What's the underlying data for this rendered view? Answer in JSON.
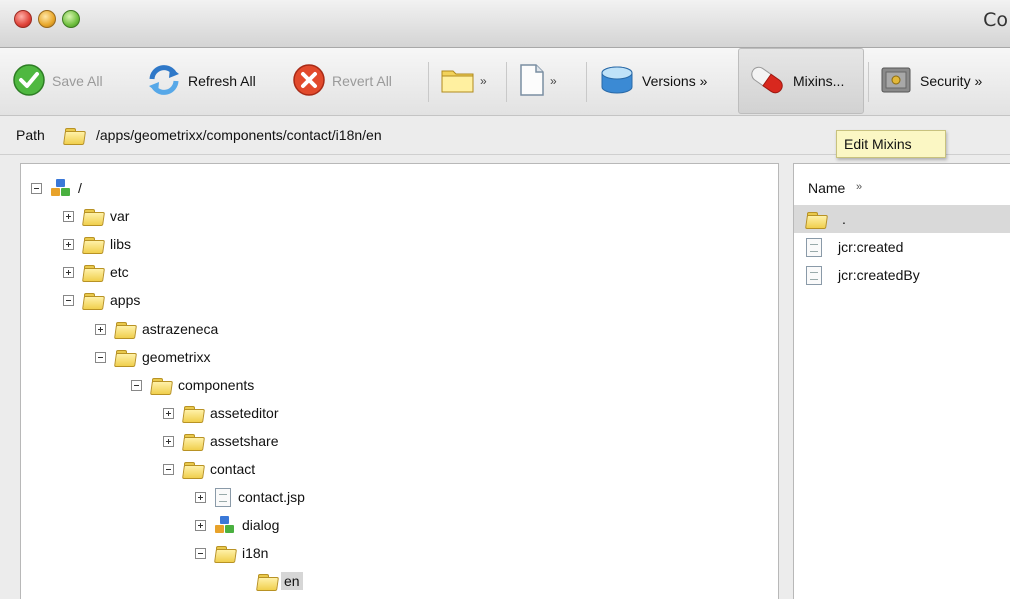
{
  "window": {
    "title": "Co"
  },
  "toolbar": {
    "save_all": "Save All",
    "refresh_all": "Refresh All",
    "revert_all": "Revert All",
    "folder_more": "»",
    "file_more": "»",
    "versions": "Versions »",
    "mixins": "Mixins...",
    "security": "Security »"
  },
  "tooltip": {
    "text": "Edit Mixins"
  },
  "path": {
    "label": "Path",
    "value": "/apps/geometrixx/components/contact/i18n/en"
  },
  "tree": {
    "nodes": [
      {
        "name": "/",
        "icon": "repository-icon",
        "state": "expanded"
      },
      {
        "name": "var",
        "icon": "folder-icon",
        "state": "collapsed"
      },
      {
        "name": "libs",
        "icon": "folder-icon",
        "state": "collapsed"
      },
      {
        "name": "etc",
        "icon": "folder-icon",
        "state": "collapsed"
      },
      {
        "name": "apps",
        "icon": "folder-icon",
        "state": "expanded"
      },
      {
        "name": "astrazeneca",
        "icon": "folder-icon",
        "state": "collapsed"
      },
      {
        "name": "geometrixx",
        "icon": "folder-icon",
        "state": "expanded"
      },
      {
        "name": "components",
        "icon": "folder-icon",
        "state": "expanded"
      },
      {
        "name": "asseteditor",
        "icon": "folder-icon",
        "state": "collapsed"
      },
      {
        "name": "assetshare",
        "icon": "folder-icon",
        "state": "collapsed"
      },
      {
        "name": "contact",
        "icon": "folder-icon",
        "state": "expanded"
      },
      {
        "name": "contact.jsp",
        "icon": "file-icon",
        "state": "collapsed"
      },
      {
        "name": "dialog",
        "icon": "dialog-node-icon",
        "state": "collapsed"
      },
      {
        "name": "i18n",
        "icon": "folder-icon",
        "state": "expanded"
      },
      {
        "name": "en",
        "icon": "folder-icon",
        "state": "selected"
      }
    ]
  },
  "properties": {
    "column_header": "Name",
    "column_more": "»",
    "rows": [
      {
        "name": ".",
        "icon": "folder-icon",
        "selected": true
      },
      {
        "name": "jcr:created",
        "icon": "date-property-icon",
        "selected": false
      },
      {
        "name": "jcr:createdBy",
        "icon": "string-property-icon",
        "selected": false
      }
    ]
  }
}
